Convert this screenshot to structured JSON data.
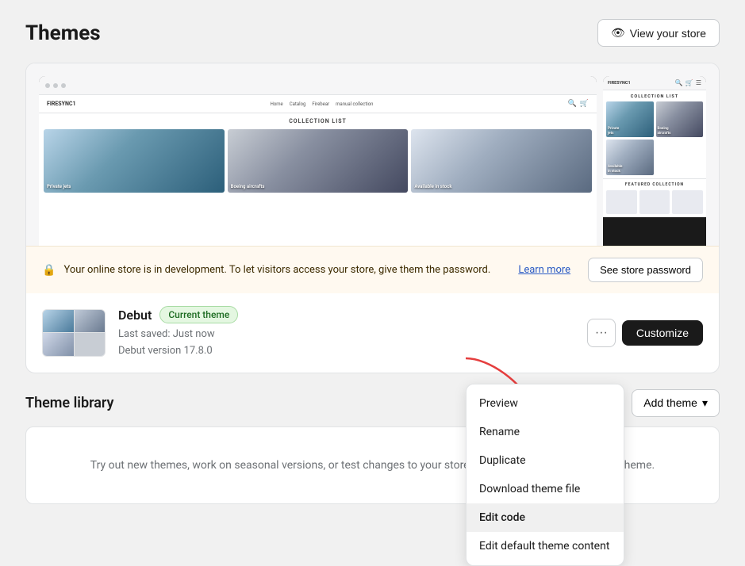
{
  "header": {
    "title": "Themes",
    "view_store_label": "View your store"
  },
  "desktop_preview": {
    "brand": "FIRESYNC1",
    "nav_links": [
      "Home",
      "Catalog",
      "Firebear",
      "manual collection"
    ],
    "collection_title": "COLLECTION LIST",
    "grid_items": [
      {
        "label": "Private jets"
      },
      {
        "label": "Boeing aircrafts"
      },
      {
        "label": "Available in stock"
      }
    ]
  },
  "mobile_preview": {
    "brand": "FIRESYNC1",
    "collection_title": "COLLECTION LIST",
    "grid_items": [
      {
        "label": "Private jets"
      },
      {
        "label": "Boeing aircrafts"
      },
      {
        "label": "Available in stock"
      }
    ],
    "featured_title": "FEATURED COLLECTION"
  },
  "password_notice": {
    "text": "Your online store is in development. To let visitors access your store, give them the password.",
    "learn_more": "Learn more",
    "button_label": "See store password"
  },
  "theme": {
    "name": "Debut",
    "badge": "Current theme",
    "last_saved": "Last saved: Just now",
    "version": "Debut version 17.8.0",
    "more_button_label": "...",
    "customize_label": "Customize"
  },
  "dropdown": {
    "items": [
      {
        "label": "Preview"
      },
      {
        "label": "Rename"
      },
      {
        "label": "Duplicate"
      },
      {
        "label": "Download theme file"
      },
      {
        "label": "Edit code"
      },
      {
        "label": "Edit default theme content"
      }
    ]
  },
  "theme_library": {
    "title": "Theme library",
    "add_theme_label": "Add theme",
    "empty_text": "Try out new themes, work on seasonal versions, or test changes to your store without affecting your current theme."
  }
}
